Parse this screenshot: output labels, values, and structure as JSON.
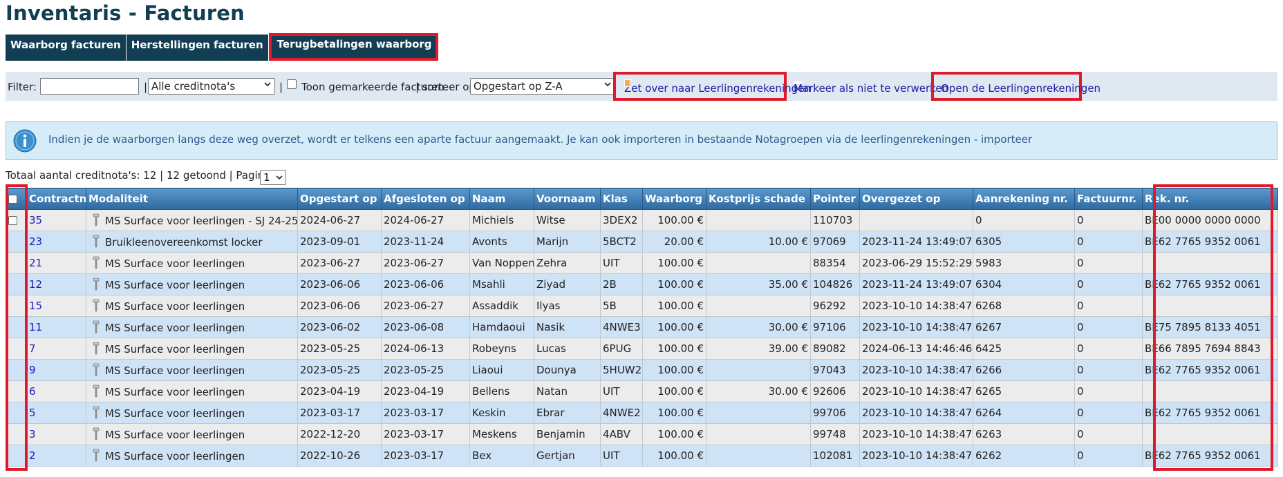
{
  "page": {
    "title": "Inventaris - Facturen"
  },
  "tabs": [
    {
      "label": "Waarborg facturen"
    },
    {
      "label": "Herstellingen facturen"
    },
    {
      "label": "Terugbetalingen waarborg"
    }
  ],
  "filter": {
    "label": "Filter:",
    "value": "",
    "sep1": "|",
    "creditnota_select": "Alle creditnota's",
    "sep2": "|",
    "show_marked_label": "Toon gemarkeerde facturen",
    "sort_label": "| sorteer op:",
    "sort_select": "Opgestart op Z-A"
  },
  "actions": {
    "transfer": "Zet over naar Leerlingenrekeningen",
    "mark_not_process": "Markeer als niet te verwerken",
    "open_accounts": "Open de Leerlingenrekeningen"
  },
  "info": {
    "text": "Indien je de waarborgen langs deze weg overzet, wordt er telkens een aparte factuur aangemaakt. Je kan ook importeren in bestaande Notagroepen via de leerlingenrekeningen - importeer"
  },
  "totals": {
    "text": "Totaal aantal creditnota's: 12 | 12 getoond | Pagina:",
    "page": "1"
  },
  "table": {
    "columns": [
      "Contractnr.",
      "Modaliteit",
      "Opgestart op",
      "Afgesloten op",
      "Naam",
      "Voornaam",
      "Klas",
      "Waarborg",
      "Kostprijs schade",
      "Pointer",
      "Overgezet op",
      "Aanrekening nr.",
      "Factuurnr.",
      "Rek. nr."
    ],
    "rows": [
      {
        "contract": "35",
        "modaliteit": "MS Surface voor leerlingen - SJ 24-25",
        "opgestart": "2024-06-27",
        "afgesloten": "2024-06-27",
        "naam": "Michiels",
        "voornaam": "Witse",
        "klas": "3DEX2",
        "waarborg": "100.00 €",
        "schade": "",
        "pointer": "110703",
        "overgezet": "",
        "aanrekening": "0",
        "factuur": "0",
        "rekening": "BE00 0000 0000 0000",
        "checkbox": true
      },
      {
        "contract": "23",
        "modaliteit": "Bruikleenovereenkomst locker",
        "opgestart": "2023-09-01",
        "afgesloten": "2023-11-24",
        "naam": "Avonts",
        "voornaam": "Marijn",
        "klas": "5BCT2",
        "waarborg": "20.00 €",
        "schade": "10.00 €",
        "pointer": "97069",
        "overgezet": "2023-11-24 13:49:07",
        "aanrekening": "6305",
        "factuur": "0",
        "rekening": "BE62 7765 9352 0061",
        "checkbox": false
      },
      {
        "contract": "21",
        "modaliteit": "MS Surface voor leerlingen",
        "opgestart": "2023-06-27",
        "afgesloten": "2023-06-27",
        "naam": "Van Noppen",
        "voornaam": "Zehra",
        "klas": "UIT",
        "waarborg": "100.00 €",
        "schade": "",
        "pointer": "88354",
        "overgezet": "2023-06-29 15:52:29",
        "aanrekening": "5983",
        "factuur": "0",
        "rekening": "",
        "checkbox": false
      },
      {
        "contract": "12",
        "modaliteit": "MS Surface voor leerlingen",
        "opgestart": "2023-06-06",
        "afgesloten": "2023-06-06",
        "naam": "Msahli",
        "voornaam": "Ziyad",
        "klas": "2B",
        "waarborg": "100.00 €",
        "schade": "35.00 €",
        "pointer": "104826",
        "overgezet": "2023-11-24 13:49:07",
        "aanrekening": "6304",
        "factuur": "0",
        "rekening": "BE62 7765 9352 0061",
        "checkbox": false
      },
      {
        "contract": "15",
        "modaliteit": "MS Surface voor leerlingen",
        "opgestart": "2023-06-06",
        "afgesloten": "2023-06-27",
        "naam": "Assaddik",
        "voornaam": "Ilyas",
        "klas": "5B",
        "waarborg": "100.00 €",
        "schade": "",
        "pointer": "96292",
        "overgezet": "2023-10-10 14:38:47",
        "aanrekening": "6268",
        "factuur": "0",
        "rekening": "",
        "checkbox": false
      },
      {
        "contract": "11",
        "modaliteit": "MS Surface voor leerlingen",
        "opgestart": "2023-06-02",
        "afgesloten": "2023-06-08",
        "naam": "Hamdaoui",
        "voornaam": "Nasik",
        "klas": "4NWE3",
        "waarborg": "100.00 €",
        "schade": "30.00 €",
        "pointer": "97106",
        "overgezet": "2023-10-10 14:38:47",
        "aanrekening": "6267",
        "factuur": "0",
        "rekening": "BE75 7895 8133 4051",
        "checkbox": false
      },
      {
        "contract": "7",
        "modaliteit": "MS Surface voor leerlingen",
        "opgestart": "2023-05-25",
        "afgesloten": "2024-06-13",
        "naam": "Robeyns",
        "voornaam": "Lucas",
        "klas": "6PUG",
        "waarborg": "100.00 €",
        "schade": "39.00 €",
        "pointer": "89082",
        "overgezet": "2024-06-13 14:46:46",
        "aanrekening": "6425",
        "factuur": "0",
        "rekening": "BE66 7895 7694 8843",
        "checkbox": false
      },
      {
        "contract": "9",
        "modaliteit": "MS Surface voor leerlingen",
        "opgestart": "2023-05-25",
        "afgesloten": "2023-05-25",
        "naam": "Liaoui",
        "voornaam": "Dounya",
        "klas": "5HUW2",
        "waarborg": "100.00 €",
        "schade": "",
        "pointer": "97043",
        "overgezet": "2023-10-10 14:38:47",
        "aanrekening": "6266",
        "factuur": "0",
        "rekening": "BE62 7765 9352 0061",
        "checkbox": false
      },
      {
        "contract": "6",
        "modaliteit": "MS Surface voor leerlingen",
        "opgestart": "2023-04-19",
        "afgesloten": "2023-04-19",
        "naam": "Bellens",
        "voornaam": "Natan",
        "klas": "UIT",
        "waarborg": "100.00 €",
        "schade": "30.00 €",
        "pointer": "92606",
        "overgezet": "2023-10-10 14:38:47",
        "aanrekening": "6265",
        "factuur": "0",
        "rekening": "",
        "checkbox": false
      },
      {
        "contract": "5",
        "modaliteit": "MS Surface voor leerlingen",
        "opgestart": "2023-03-17",
        "afgesloten": "2023-03-17",
        "naam": "Keskin",
        "voornaam": "Ebrar",
        "klas": "4NWE2",
        "waarborg": "100.00 €",
        "schade": "",
        "pointer": "99706",
        "overgezet": "2023-10-10 14:38:47",
        "aanrekening": "6264",
        "factuur": "0",
        "rekening": "BE62 7765 9352 0061",
        "checkbox": false
      },
      {
        "contract": "3",
        "modaliteit": "MS Surface voor leerlingen",
        "opgestart": "2022-12-20",
        "afgesloten": "2023-03-17",
        "naam": "Meskens",
        "voornaam": "Benjamin",
        "klas": "4ABV",
        "waarborg": "100.00 €",
        "schade": "",
        "pointer": "99748",
        "overgezet": "2023-10-10 14:38:47",
        "aanrekening": "6263",
        "factuur": "0",
        "rekening": "",
        "checkbox": false
      },
      {
        "contract": "2",
        "modaliteit": "MS Surface voor leerlingen",
        "opgestart": "2022-10-26",
        "afgesloten": "2023-03-17",
        "naam": "Bex",
        "voornaam": "Gertjan",
        "klas": "UIT",
        "waarborg": "100.00 €",
        "schade": "",
        "pointer": "102081",
        "overgezet": "2023-10-10 14:38:47",
        "aanrekening": "6262",
        "factuur": "0",
        "rekening": "BE62 7765 9352 0061",
        "checkbox": false
      }
    ]
  },
  "colors": {
    "title": "#123d52",
    "tab_bg": "#123d52",
    "highlight": "#e01a2a",
    "header_bg": "#3e7cb2",
    "link": "#1a1ac0",
    "row_odd": "#ececec",
    "row_even": "#cfe3f6"
  }
}
